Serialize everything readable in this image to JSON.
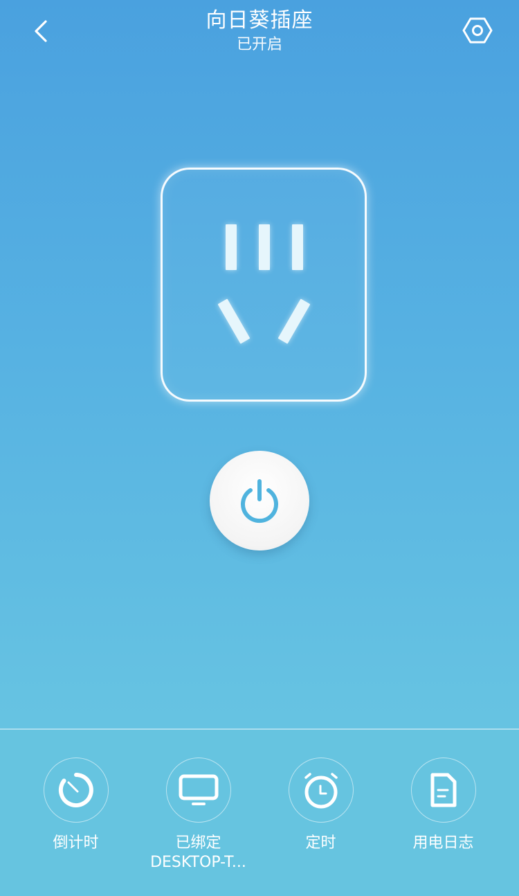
{
  "header": {
    "title": "向日葵插座",
    "status": "已开启",
    "back_icon": "chevron-left-icon",
    "settings_icon": "hexagon-gear-icon"
  },
  "socket": {
    "icon": "power-outlet-icon"
  },
  "power_button": {
    "icon": "power-icon",
    "accent_color": "#4fb3de"
  },
  "actions": [
    {
      "label": "倒计时",
      "icon": "countdown-timer-icon"
    },
    {
      "label": "已绑定",
      "sublabel": "DESKTOP-T...",
      "icon": "monitor-icon"
    },
    {
      "label": "定时",
      "icon": "alarm-clock-icon"
    },
    {
      "label": "用电日志",
      "icon": "document-log-icon"
    }
  ],
  "colors": {
    "background_top": "#4aa1df",
    "background_bottom": "#68c6e1",
    "bottom_bar": "#66c4e0"
  }
}
